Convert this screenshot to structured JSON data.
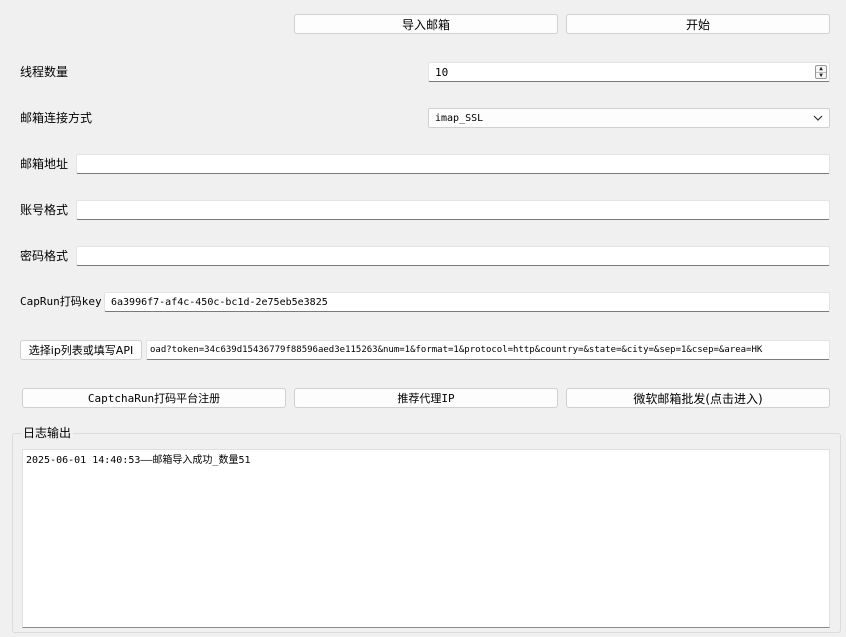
{
  "toolbar": {
    "import_label": "导入邮箱",
    "start_label": "开始"
  },
  "form": {
    "threads": {
      "label": "线程数量",
      "value": "10"
    },
    "connection": {
      "label": "邮箱连接方式",
      "selected": "imap_SSL"
    },
    "address": {
      "label": "邮箱地址",
      "value": ""
    },
    "account_format": {
      "label": "账号格式",
      "value": ""
    },
    "password_format": {
      "label": "密码格式",
      "value": ""
    },
    "capkey": {
      "label": "CapRun打码key",
      "value": "6a3996f7-af4c-450c-bc1d-2e75eb5e3825"
    },
    "ip": {
      "button_label": "选择ip列表或填写API",
      "value": "oad?token=34c639d15436779f88596aed3e115263&num=1&format=1&protocol=http&country=&state=&city=&sep=1&csep=&area=HK"
    }
  },
  "links": {
    "register_label": "CaptchaRun打码平台注册",
    "proxy_label": "推荐代理IP",
    "ms_batch_label": "微软邮箱批发(点击进入)"
  },
  "log": {
    "title": "日志输出",
    "text": "2025-06-01 14:40:53——邮箱导入成功_数量51"
  }
}
